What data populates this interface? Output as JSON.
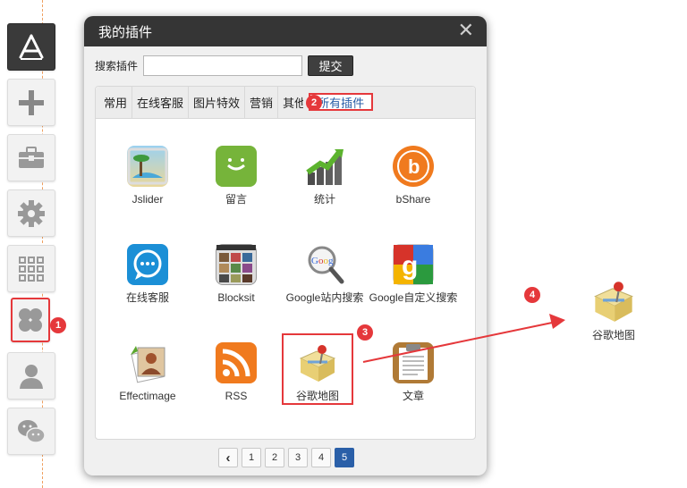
{
  "dialog": {
    "title": "我的插件",
    "close_glyph": "✕",
    "search_label": "搜索插件",
    "search_value": "",
    "search_placeholder": "",
    "submit_label": "提交",
    "tabs": [
      {
        "label": "常用"
      },
      {
        "label": "在线客服"
      },
      {
        "label": "图片特效"
      },
      {
        "label": "营销"
      },
      {
        "label": "其他"
      },
      {
        "label": "所有插件"
      }
    ],
    "plugins": [
      {
        "label": "Jslider",
        "icon": "image-slider-icon"
      },
      {
        "label": "留言",
        "icon": "message-bubble-icon"
      },
      {
        "label": "统计",
        "icon": "stats-chart-icon"
      },
      {
        "label": "bShare",
        "icon": "bshare-icon"
      },
      {
        "label": "在线客服",
        "icon": "chat-bubble-icon"
      },
      {
        "label": "Blocksit",
        "icon": "photo-grid-icon"
      },
      {
        "label": "Google站内搜索",
        "icon": "google-search-icon"
      },
      {
        "label": "Google自定义搜索",
        "icon": "google-custom-icon"
      },
      {
        "label": "Effectimage",
        "icon": "effect-image-icon"
      },
      {
        "label": "RSS",
        "icon": "rss-icon"
      },
      {
        "label": "谷歌地图",
        "icon": "map-pin-icon"
      },
      {
        "label": "文章",
        "icon": "article-clipboard-icon"
      }
    ],
    "pager": {
      "prev_glyph": "‹",
      "pages": [
        "1",
        "2",
        "3",
        "4",
        "5"
      ],
      "current": "5"
    }
  },
  "toolbar": {
    "items": [
      {
        "name": "app-store-icon"
      },
      {
        "name": "add-icon"
      },
      {
        "name": "toolbox-icon"
      },
      {
        "name": "gear-icon"
      },
      {
        "name": "apps-grid-icon"
      },
      {
        "name": "plugins-icon"
      },
      {
        "name": "user-icon"
      },
      {
        "name": "wechat-icon"
      }
    ]
  },
  "steps": [
    "1",
    "2",
    "3",
    "4"
  ],
  "dragged_item": {
    "label": "谷歌地图",
    "icon": "map-pin-icon"
  },
  "colors": {
    "accent_red": "#e5383b",
    "header_dark": "#353535",
    "link_blue": "#2a5fa8"
  }
}
